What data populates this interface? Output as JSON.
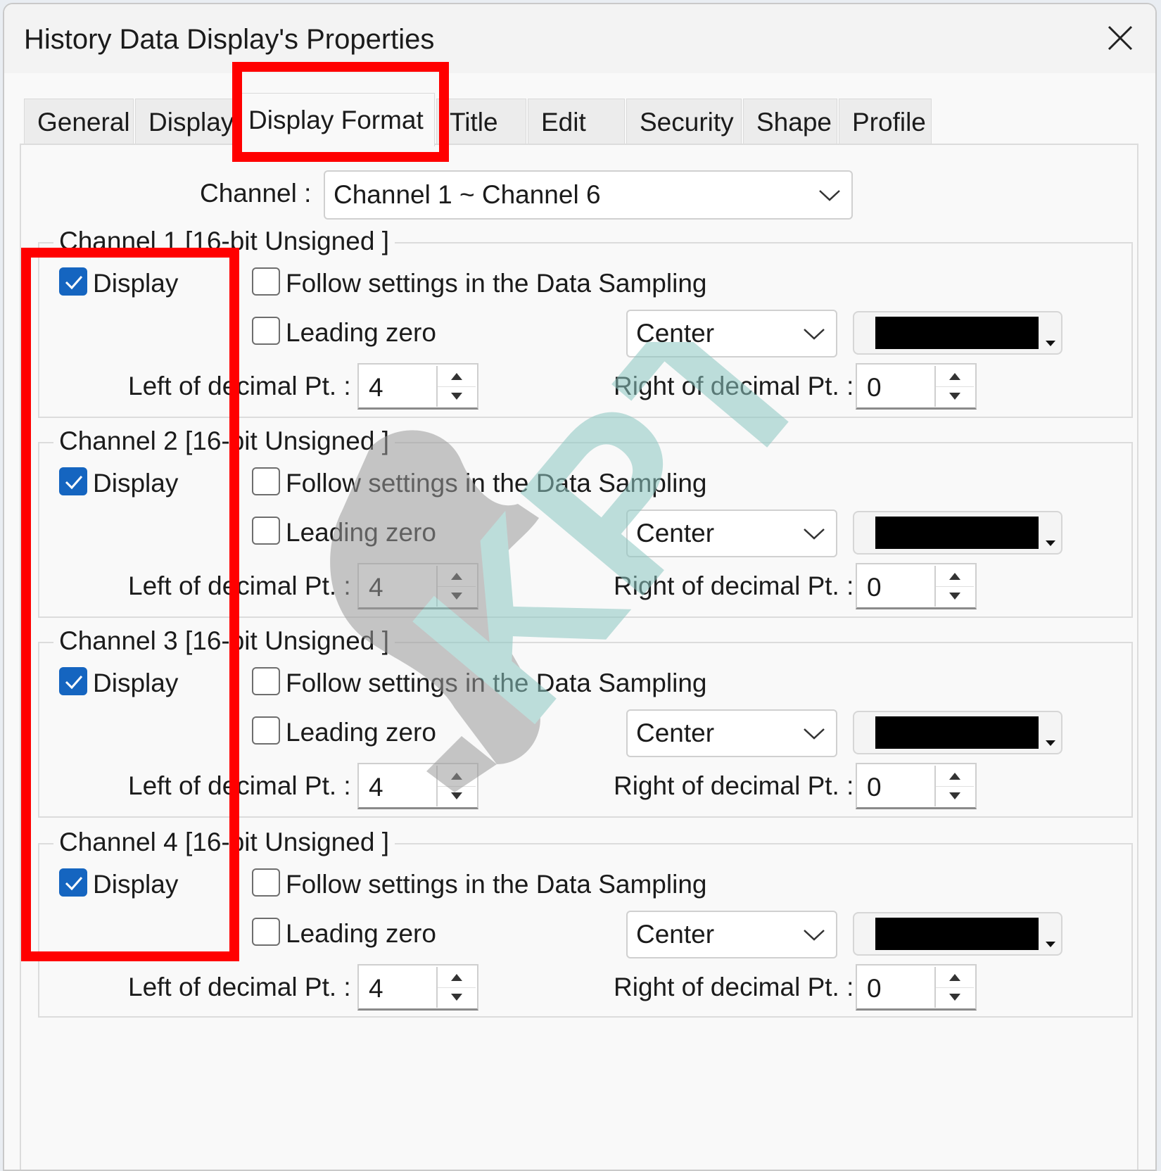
{
  "window": {
    "title": "History Data Display's Properties"
  },
  "tabs": [
    {
      "label": "General"
    },
    {
      "label": "Display"
    },
    {
      "label": "Display Format"
    },
    {
      "label": "Title"
    },
    {
      "label": "Edit"
    },
    {
      "label": "Security"
    },
    {
      "label": "Shape"
    },
    {
      "label": "Profile"
    }
  ],
  "active_tab": "Display Format",
  "channel_select": {
    "label": "Channel :",
    "value": "Channel 1 ~ Channel 6"
  },
  "channels": [
    {
      "title": "Channel 1 [16-bit Unsigned ]",
      "display_label": "Display",
      "display_checked": true,
      "follow_label": "Follow settings in the Data Sampling",
      "follow_checked": false,
      "leading_label": "Leading zero",
      "leading_checked": false,
      "align": "Center",
      "color": "#000000",
      "left_label": "Left of decimal Pt. :",
      "left_value": "4",
      "right_label": "Right of decimal Pt. :",
      "right_value": "0"
    },
    {
      "title": "Channel 2 [16-bit Unsigned ]",
      "display_label": "Display",
      "display_checked": true,
      "follow_label": "Follow settings in the Data Sampling",
      "follow_checked": false,
      "leading_label": "Leading zero",
      "leading_checked": false,
      "align": "Center",
      "color": "#000000",
      "left_label": "Left of decimal Pt. :",
      "left_value": "4",
      "right_label": "Right of decimal Pt. :",
      "right_value": "0"
    },
    {
      "title": "Channel 3 [16-bit Unsigned ]",
      "display_label": "Display",
      "display_checked": true,
      "follow_label": "Follow settings in the Data Sampling",
      "follow_checked": false,
      "leading_label": "Leading zero",
      "leading_checked": false,
      "align": "Center",
      "color": "#000000",
      "left_label": "Left of decimal Pt. :",
      "left_value": "4",
      "right_label": "Right of decimal Pt. :",
      "right_value": "0"
    },
    {
      "title": "Channel 4 [16-bit Unsigned ]",
      "display_label": "Display",
      "display_checked": true,
      "follow_label": "Follow settings in the Data Sampling",
      "follow_checked": false,
      "leading_label": "Leading zero",
      "leading_checked": false,
      "align": "Center",
      "color": "#000000",
      "left_label": "Left of decimal Pt. :",
      "left_value": "4",
      "right_label": "Right of decimal Pt. :",
      "right_value": "0"
    }
  ],
  "watermark": {
    "text": "KPT"
  },
  "colors": {
    "highlight": "#ff0000",
    "checkbox_accent": "#1565c0"
  }
}
